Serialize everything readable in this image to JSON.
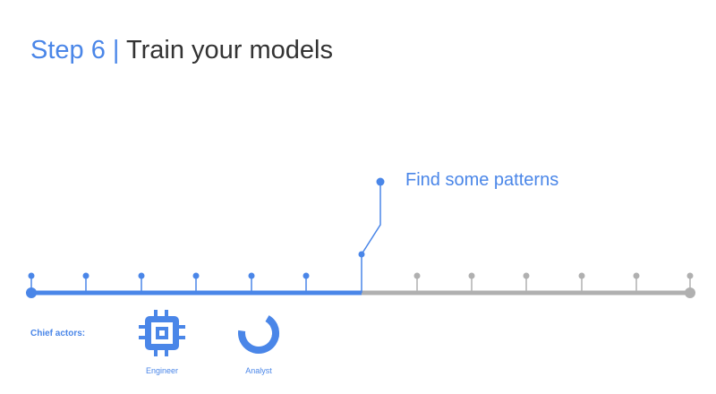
{
  "header": {
    "step": "Step 6 |",
    "title": "Train your models"
  },
  "timeline": {
    "milestone_label": "Find some patterns",
    "completed_ticks": 6,
    "remaining_ticks": 6,
    "progress_color": "#4a86e8",
    "remaining_color": "#b0b0b0"
  },
  "actors": {
    "label": "Chief actors:",
    "items": [
      {
        "name": "Engineer",
        "icon": "chip-icon"
      },
      {
        "name": "Analyst",
        "icon": "donut-chart-icon"
      }
    ]
  }
}
